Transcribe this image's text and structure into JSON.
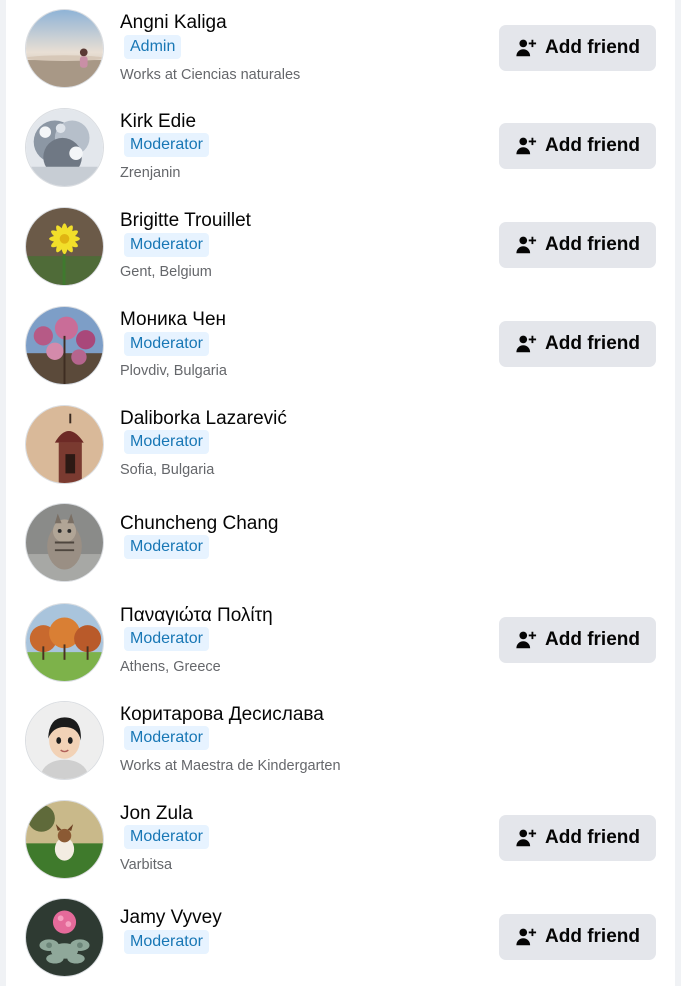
{
  "members": [
    {
      "name": "Angni Kaliga",
      "role": "Admin",
      "subtitle": "Works at Ciencias naturales",
      "button": "Add friend",
      "avatar": "beach-sunset"
    },
    {
      "name": "Kirk Edie",
      "role": "Moderator",
      "subtitle": "Zrenjanin",
      "button": "Add friend",
      "avatar": "frosted-tree"
    },
    {
      "name": "Brigitte Trouillet",
      "role": "Moderator",
      "subtitle": "Gent, Belgium",
      "button": "Add friend",
      "avatar": "yellow-flower"
    },
    {
      "name": "Моника Чен",
      "role": "Moderator",
      "subtitle": "Plovdiv, Bulgaria",
      "button": "Add friend",
      "avatar": "pink-blossoms"
    },
    {
      "name": "Daliborka Lazarević",
      "role": "Moderator",
      "subtitle": "Sofia, Bulgaria",
      "button": "",
      "avatar": "chapel-dome"
    },
    {
      "name": "Chuncheng Chang",
      "role": "Moderator",
      "subtitle": "",
      "button": "",
      "avatar": "tabby-cat"
    },
    {
      "name": "Παναγιώτα Πολίτη",
      "role": "Moderator",
      "subtitle": "Athens, Greece",
      "button": "Add friend",
      "avatar": "autumn-trees"
    },
    {
      "name": "Коритарова Десислава",
      "role": "Moderator",
      "subtitle": "Works at Maestra de Kindergarten",
      "button": "",
      "avatar": "cartoon-woman"
    },
    {
      "name": "Jon Zula",
      "role": "Moderator",
      "subtitle": "Varbitsa",
      "button": "Add friend",
      "avatar": "dog-on-grass"
    },
    {
      "name": "Jamy Vyvey",
      "role": "Moderator",
      "subtitle": "",
      "button": "Add friend",
      "avatar": "pink-succulent"
    }
  ],
  "colors": {
    "badge_bg": "#e7f3ff",
    "badge_text": "#1877b5",
    "button_bg": "#e4e6eb",
    "subtitle_text": "#65676b"
  },
  "icons": {
    "button_icon": "person-add-icon"
  }
}
